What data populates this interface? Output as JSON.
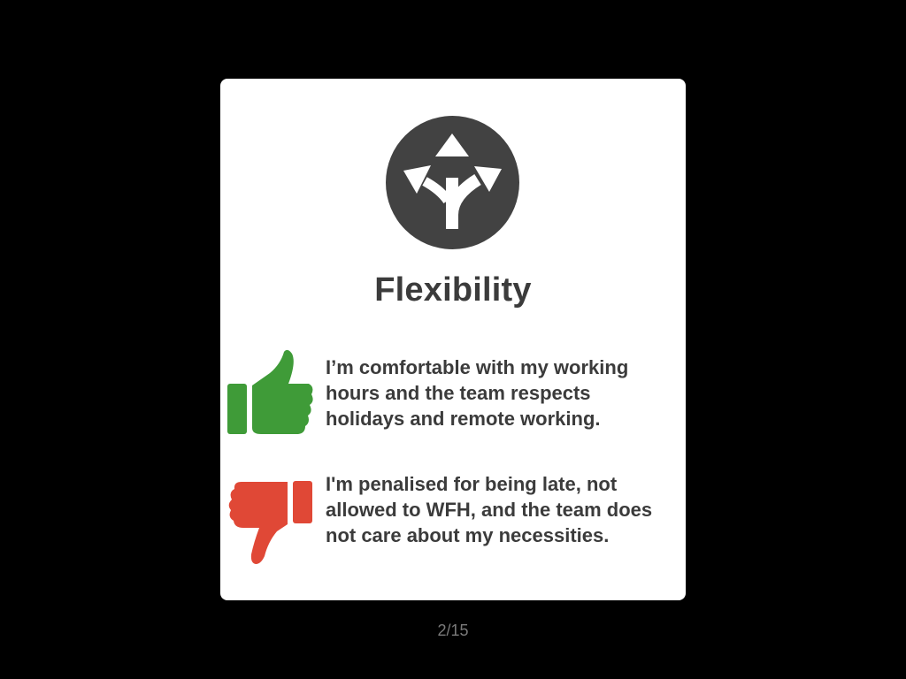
{
  "card": {
    "title": "Flexibility",
    "hero_icon": "split-arrows-icon",
    "positive": {
      "icon": "thumbs-up-icon",
      "color": "#3f9b38",
      "text": "I’m comfortable with my working hours and the team respects holidays and remote working."
    },
    "negative": {
      "icon": "thumbs-down-icon",
      "color": "#e04836",
      "text": "I'm penalised for being late, not allowed to WFH, and the team does not care about my necessities."
    }
  },
  "pager": {
    "label": "2/15"
  },
  "colors": {
    "background": "#000000",
    "card": "#ffffff",
    "icon_circle": "#424242",
    "text": "#3b3b3b"
  }
}
